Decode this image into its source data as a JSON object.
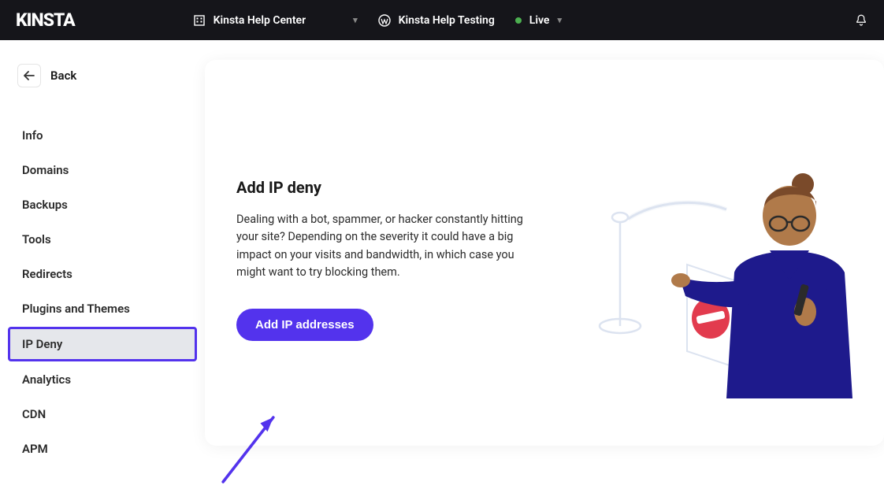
{
  "topbar": {
    "logo": "KINSTA",
    "org_selector": "Kinsta Help Center",
    "site_selector": "Kinsta Help Testing",
    "env_label": "Live"
  },
  "sidebar": {
    "back_label": "Back",
    "items": [
      {
        "label": "Info"
      },
      {
        "label": "Domains"
      },
      {
        "label": "Backups"
      },
      {
        "label": "Tools"
      },
      {
        "label": "Redirects"
      },
      {
        "label": "Plugins and Themes"
      },
      {
        "label": "IP Deny",
        "active": true
      },
      {
        "label": "Analytics"
      },
      {
        "label": "CDN"
      },
      {
        "label": "APM"
      }
    ]
  },
  "main": {
    "title": "Add IP deny",
    "description": "Dealing with a bot, spammer, or hacker constantly hitting your site? Depending on the severity it could have a big impact on your visits and bandwidth, in which case you might want to try blocking them.",
    "button_label": "Add IP addresses"
  },
  "colors": {
    "accent": "#5333ED",
    "topbar_bg": "#15151a",
    "status_green": "#4caf50"
  }
}
